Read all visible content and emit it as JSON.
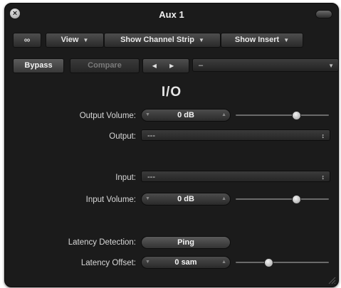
{
  "window": {
    "title": "Aux 1",
    "close_icon": "×"
  },
  "toolbar": {
    "link_icon": "∞",
    "view_label": "View",
    "channel_strip_label": "Show Channel Strip",
    "insert_label": "Show Insert"
  },
  "plugin_bar": {
    "bypass_label": "Bypass",
    "compare_label": "Compare",
    "prev_next": "◀ ▶",
    "preset_value": "–"
  },
  "heading": "I/O",
  "output_volume": {
    "label": "Output Volume:",
    "value": "0 dB",
    "slider_level": 0.65
  },
  "output": {
    "label": "Output:",
    "value": "---"
  },
  "input": {
    "label": "Input:",
    "value": "---"
  },
  "input_volume": {
    "label": "Input Volume:",
    "value": "0 dB",
    "slider_level": 0.65
  },
  "latency_detection": {
    "label": "Latency Detection:",
    "button_label": "Ping"
  },
  "latency_offset": {
    "label": "Latency Offset:",
    "value": "0 sam",
    "slider_level": 0.35
  },
  "icons": {
    "dropdown_arrow": "▼",
    "stepper_dec": "▼",
    "stepper_inc": "▲",
    "updown": "↕"
  }
}
